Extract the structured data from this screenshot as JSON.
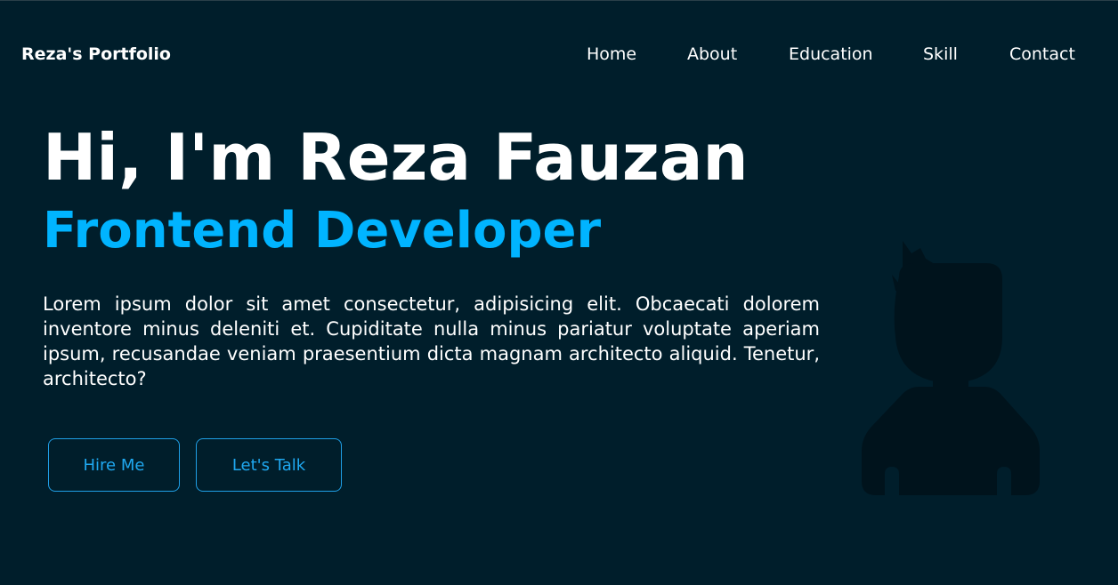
{
  "navbar": {
    "brand": "Reza's Portfolio",
    "links": [
      "Home",
      "About",
      "Education",
      "Skill",
      "Contact"
    ]
  },
  "hero": {
    "title": "Hi, I'm Reza Fauzan",
    "subtitle": "Frontend Developer",
    "description": "Lorem ipsum dolor sit amet consectetur, adipisicing elit. Obcaecati dolorem inventore minus deleniti et. Cupiditate nulla minus pariatur voluptate aperiam ipsum, recusandae veniam praesentium dicta magnam architecto aliquid. Tenetur, architecto?",
    "buttons": {
      "hire": "Hire Me",
      "talk": "Let's Talk"
    },
    "avatar_icon": "person-silhouette-icon"
  },
  "colors": {
    "background": "#001e2b",
    "accent": "#00b4ff",
    "text": "#ffffff",
    "silhouette": "#00131c"
  }
}
